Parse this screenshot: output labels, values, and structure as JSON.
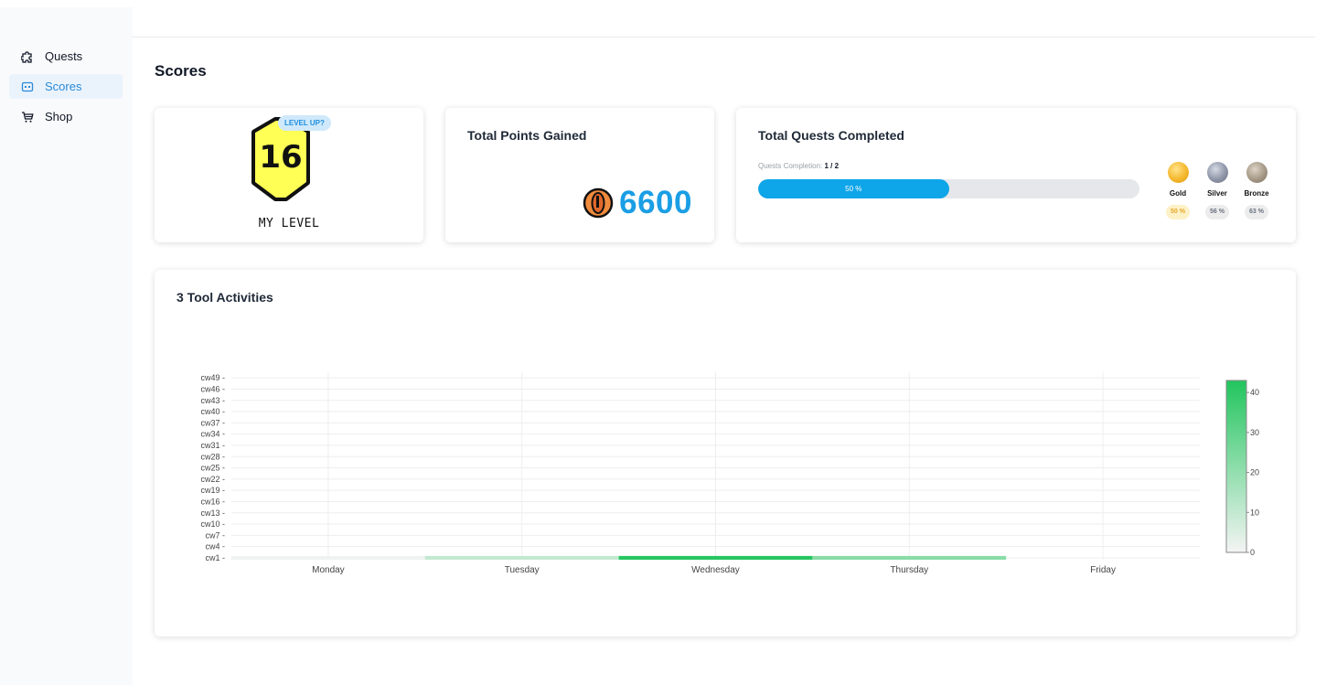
{
  "sidebar": {
    "items": [
      {
        "label": "Quests",
        "icon": "puzzle-icon",
        "active": false
      },
      {
        "label": "Scores",
        "icon": "scoreboard-icon",
        "active": true
      },
      {
        "label": "Shop",
        "icon": "cart-icon",
        "active": false
      }
    ]
  },
  "page": {
    "title": "Scores"
  },
  "level": {
    "value": "16",
    "label": "MY LEVEL",
    "badge": "LEVEL UP?"
  },
  "points": {
    "title": "Total Points Gained",
    "value": "6600",
    "icon": "coin-icon"
  },
  "quests": {
    "title": "Total Quests Completed",
    "completion_label": "Quests Completion:",
    "completion_value": "1 / 2",
    "progress_fraction": 0.5,
    "progress_text": "50 %",
    "medals": [
      {
        "name": "Gold",
        "percent": "50 %",
        "color": "#f5b82e"
      },
      {
        "name": "Silver",
        "percent": "56 %",
        "color": "#8f96a8"
      },
      {
        "name": "Bronze",
        "percent": "63 %",
        "color": "#a59886"
      }
    ]
  },
  "activities": {
    "title": "3 Tool Activities"
  },
  "colors": {
    "accent": "#2b8ad6",
    "points": "#1a9ee5",
    "progress": "#0ea5e9",
    "heat_max": "#22c55e"
  },
  "chart_data": {
    "type": "heatmap",
    "title": "3 Tool Activities",
    "x": [
      "Monday",
      "Tuesday",
      "Wednesday",
      "Thursday",
      "Friday"
    ],
    "y_ticks": [
      "cw1",
      "cw4",
      "cw7",
      "cw10",
      "cw13",
      "cw16",
      "cw19",
      "cw22",
      "cw25",
      "cw28",
      "cw31",
      "cw34",
      "cw37",
      "cw40",
      "cw43",
      "cw46",
      "cw49"
    ],
    "y_range": [
      "cw1",
      "cw50"
    ],
    "rows": [
      {
        "y": "cw1",
        "values": [
          1,
          10,
          42,
          22,
          0
        ]
      }
    ],
    "colorbar": {
      "min": 0,
      "max": 43,
      "ticks": [
        0,
        10,
        20,
        30,
        40
      ],
      "colors": [
        "#f4f4f4",
        "#22c55e"
      ]
    },
    "grid": true
  }
}
